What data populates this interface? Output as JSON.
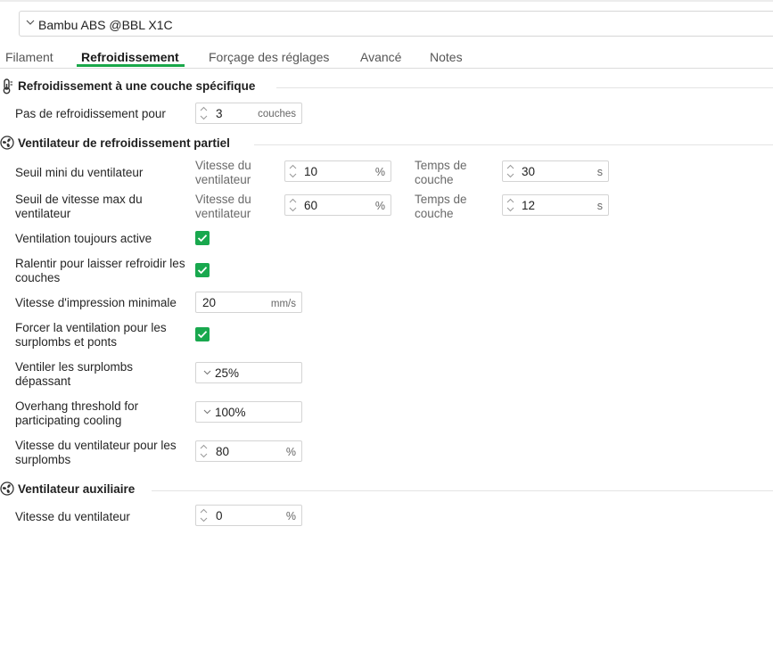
{
  "preset": {
    "value": "Bambu ABS @BBL X1C"
  },
  "tabs": [
    {
      "label": "Filament"
    },
    {
      "label": "Refroidissement"
    },
    {
      "label": "Forçage des réglages"
    },
    {
      "label": "Avancé"
    },
    {
      "label": "Notes"
    }
  ],
  "active_tab_color": "#1aa84a",
  "checkbox_color": "#19a84e",
  "sections": {
    "specific_layer": {
      "title": "Refroidissement à une couche spécifique",
      "icon": "thermometer-icon",
      "cooling_steps": {
        "label": "Pas de refroidissement pour",
        "value": "3",
        "unit": "couches"
      }
    },
    "partial_fan": {
      "title": "Ventilateur de refroidissement partiel",
      "icon": "fan-icon",
      "min_fan": {
        "label": "Seuil mini du ventilateur",
        "speed_label": "Vitesse du ventilateur",
        "speed_value": "10",
        "speed_unit": "%",
        "layer_label": "Temps de couche",
        "layer_value": "30",
        "layer_unit": "s"
      },
      "max_fan": {
        "label": "Seuil de vitesse max du ventilateur",
        "speed_label": "Vitesse du ventilateur",
        "speed_value": "60",
        "speed_unit": "%",
        "layer_label": "Temps de couche",
        "layer_value": "12",
        "layer_unit": "s"
      },
      "always_on": {
        "label": "Ventilation toujours active",
        "checked": true
      },
      "slow_down": {
        "label": "Ralentir pour laisser refroidir les couches",
        "checked": true
      },
      "min_speed": {
        "label": "Vitesse d'impression minimale",
        "value": "20",
        "unit": "mm/s"
      },
      "force_overhang": {
        "label": "Forcer la ventilation pour les surplombs et ponts",
        "checked": true
      },
      "overhang_exceed": {
        "label": "Ventiler les surplombs dépassant",
        "value": "25%"
      },
      "overhang_threshold": {
        "label": "Overhang threshold for participating cooling",
        "value": "100%"
      },
      "overhang_fan_speed": {
        "label": "Vitesse du ventilateur pour les surplombs",
        "value": "80",
        "unit": "%"
      }
    },
    "aux_fan": {
      "title": "Ventilateur auxiliaire",
      "icon": "fan-icon",
      "fan_speed": {
        "label": "Vitesse du ventilateur",
        "value": "0",
        "unit": "%"
      }
    }
  }
}
